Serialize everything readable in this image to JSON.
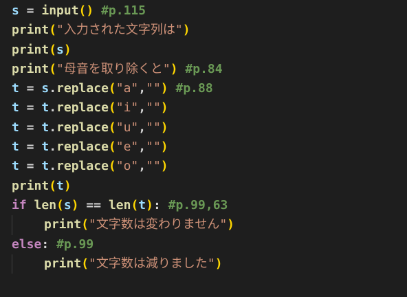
{
  "colors": {
    "background": "#1e1e1e",
    "variable": "#9cdcfe",
    "function": "#dcdcaa",
    "keyword": "#c586c0",
    "string": "#ce9178",
    "comment": "#6a9955",
    "bracket_level1": "#ffd700",
    "bracket_level2": "#da70d6"
  },
  "code": {
    "lines": [
      {
        "indent": 0,
        "tokens": [
          {
            "t": "s",
            "k": "var"
          },
          {
            "t": " = ",
            "k": "op"
          },
          {
            "t": "input",
            "k": "fn"
          },
          {
            "t": "()",
            "k": "p1"
          },
          {
            "t": " ",
            "k": "op"
          },
          {
            "t": "#p.115",
            "k": "cm"
          }
        ]
      },
      {
        "indent": 0,
        "tokens": [
          {
            "t": "print",
            "k": "fn"
          },
          {
            "t": "(",
            "k": "p1"
          },
          {
            "t": "\"入力された文字列は\"",
            "k": "str"
          },
          {
            "t": ")",
            "k": "p1"
          }
        ]
      },
      {
        "indent": 0,
        "tokens": [
          {
            "t": "print",
            "k": "fn"
          },
          {
            "t": "(",
            "k": "p1"
          },
          {
            "t": "s",
            "k": "var"
          },
          {
            "t": ")",
            "k": "p1"
          }
        ]
      },
      {
        "indent": 0,
        "tokens": [
          {
            "t": "print",
            "k": "fn"
          },
          {
            "t": "(",
            "k": "p1"
          },
          {
            "t": "\"母音を取り除くと\"",
            "k": "str"
          },
          {
            "t": ")",
            "k": "p1"
          },
          {
            "t": " ",
            "k": "op"
          },
          {
            "t": "#p.84",
            "k": "cm"
          }
        ]
      },
      {
        "indent": 0,
        "tokens": [
          {
            "t": "t",
            "k": "var"
          },
          {
            "t": " = ",
            "k": "op"
          },
          {
            "t": "s",
            "k": "var"
          },
          {
            "t": ".",
            "k": "op"
          },
          {
            "t": "replace",
            "k": "fn"
          },
          {
            "t": "(",
            "k": "p1"
          },
          {
            "t": "\"a\"",
            "k": "str"
          },
          {
            "t": ",",
            "k": "op"
          },
          {
            "t": "\"\"",
            "k": "str"
          },
          {
            "t": ")",
            "k": "p1"
          },
          {
            "t": " ",
            "k": "op"
          },
          {
            "t": "#p.88",
            "k": "cm"
          }
        ]
      },
      {
        "indent": 0,
        "tokens": [
          {
            "t": "t",
            "k": "var"
          },
          {
            "t": " = ",
            "k": "op"
          },
          {
            "t": "t",
            "k": "var"
          },
          {
            "t": ".",
            "k": "op"
          },
          {
            "t": "replace",
            "k": "fn"
          },
          {
            "t": "(",
            "k": "p1"
          },
          {
            "t": "\"i\"",
            "k": "str"
          },
          {
            "t": ",",
            "k": "op"
          },
          {
            "t": "\"\"",
            "k": "str"
          },
          {
            "t": ")",
            "k": "p1"
          }
        ]
      },
      {
        "indent": 0,
        "tokens": [
          {
            "t": "t",
            "k": "var"
          },
          {
            "t": " = ",
            "k": "op"
          },
          {
            "t": "t",
            "k": "var"
          },
          {
            "t": ".",
            "k": "op"
          },
          {
            "t": "replace",
            "k": "fn"
          },
          {
            "t": "(",
            "k": "p1"
          },
          {
            "t": "\"u\"",
            "k": "str"
          },
          {
            "t": ",",
            "k": "op"
          },
          {
            "t": "\"\"",
            "k": "str"
          },
          {
            "t": ")",
            "k": "p1"
          }
        ]
      },
      {
        "indent": 0,
        "tokens": [
          {
            "t": "t",
            "k": "var"
          },
          {
            "t": " = ",
            "k": "op"
          },
          {
            "t": "t",
            "k": "var"
          },
          {
            "t": ".",
            "k": "op"
          },
          {
            "t": "replace",
            "k": "fn"
          },
          {
            "t": "(",
            "k": "p1"
          },
          {
            "t": "\"e\"",
            "k": "str"
          },
          {
            "t": ",",
            "k": "op"
          },
          {
            "t": "\"\"",
            "k": "str"
          },
          {
            "t": ")",
            "k": "p1"
          }
        ]
      },
      {
        "indent": 0,
        "tokens": [
          {
            "t": "t",
            "k": "var"
          },
          {
            "t": " = ",
            "k": "op"
          },
          {
            "t": "t",
            "k": "var"
          },
          {
            "t": ".",
            "k": "op"
          },
          {
            "t": "replace",
            "k": "fn"
          },
          {
            "t": "(",
            "k": "p1"
          },
          {
            "t": "\"o\"",
            "k": "str"
          },
          {
            "t": ",",
            "k": "op"
          },
          {
            "t": "\"\"",
            "k": "str"
          },
          {
            "t": ")",
            "k": "p1"
          }
        ]
      },
      {
        "indent": 0,
        "tokens": [
          {
            "t": "print",
            "k": "fn"
          },
          {
            "t": "(",
            "k": "p1"
          },
          {
            "t": "t",
            "k": "var"
          },
          {
            "t": ")",
            "k": "p1"
          }
        ]
      },
      {
        "indent": 0,
        "tokens": [
          {
            "t": "if",
            "k": "kw"
          },
          {
            "t": " ",
            "k": "op"
          },
          {
            "t": "len",
            "k": "fn"
          },
          {
            "t": "(",
            "k": "p1"
          },
          {
            "t": "s",
            "k": "var"
          },
          {
            "t": ")",
            "k": "p1"
          },
          {
            "t": " == ",
            "k": "op"
          },
          {
            "t": "len",
            "k": "fn"
          },
          {
            "t": "(",
            "k": "p1"
          },
          {
            "t": "t",
            "k": "var"
          },
          {
            "t": ")",
            "k": "p1"
          },
          {
            "t": ": ",
            "k": "op"
          },
          {
            "t": "#p.99,63",
            "k": "cm"
          }
        ]
      },
      {
        "indent": 1,
        "tokens": [
          {
            "t": "print",
            "k": "fn"
          },
          {
            "t": "(",
            "k": "p1"
          },
          {
            "t": "\"文字数は変わりません\"",
            "k": "str"
          },
          {
            "t": ")",
            "k": "p1"
          }
        ]
      },
      {
        "indent": 0,
        "tokens": [
          {
            "t": "else",
            "k": "kw"
          },
          {
            "t": ": ",
            "k": "op"
          },
          {
            "t": "#p.99",
            "k": "cm"
          }
        ]
      },
      {
        "indent": 1,
        "tokens": [
          {
            "t": "print",
            "k": "fn"
          },
          {
            "t": "(",
            "k": "p1"
          },
          {
            "t": "\"文字数は減りました\"",
            "k": "str"
          },
          {
            "t": ")",
            "k": "p1"
          }
        ]
      }
    ]
  }
}
